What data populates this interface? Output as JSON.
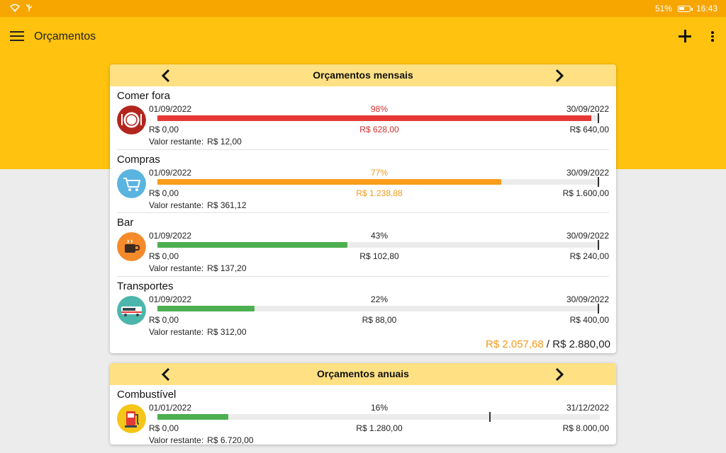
{
  "status": {
    "battery": "51%",
    "time": "16:43"
  },
  "app": {
    "title": "Orçamentos"
  },
  "monthly": {
    "title": "Orçamentos mensais",
    "items": [
      {
        "name": "Comer fora",
        "icon": "dinner-plate-icon",
        "start": "01/09/2022",
        "end": "30/09/2022",
        "pct": "98%",
        "progress": 0.98,
        "marker": 0.995,
        "min": "R$ 0,00",
        "spent": "R$ 628,00",
        "limit": "R$ 640,00",
        "rem_label": "Valor restante:",
        "rem": "R$ 12,00",
        "color": "#e53935",
        "text_color": "#d32f2f"
      },
      {
        "name": "Compras",
        "icon": "shopping-cart-icon",
        "start": "01/09/2022",
        "end": "30/09/2022",
        "pct": "77%",
        "progress": 0.777,
        "marker": 0.995,
        "min": "R$ 0,00",
        "spent": "R$ 1.238,88",
        "limit": "R$ 1.600,00",
        "rem_label": "Valor restante:",
        "rem": "R$ 361,12",
        "color": "#f99d1c",
        "text_color": "#f29a1c"
      },
      {
        "name": "Bar",
        "icon": "coffee-cup-icon",
        "start": "01/09/2022",
        "end": "30/09/2022",
        "pct": "43%",
        "progress": 0.43,
        "marker": 0.995,
        "min": "R$ 0,00",
        "spent": "R$ 102,80",
        "limit": "R$ 240,00",
        "rem_label": "Valor restante:",
        "rem": "R$ 137,20",
        "color": "#4caf50",
        "text_color": "#222222"
      },
      {
        "name": "Transportes",
        "icon": "bus-icon",
        "start": "01/09/2022",
        "end": "30/09/2022",
        "pct": "22%",
        "progress": 0.22,
        "marker": 0.995,
        "min": "R$ 0,00",
        "spent": "R$ 88,00",
        "limit": "R$ 400,00",
        "rem_label": "Valor restante:",
        "rem": "R$ 312,00",
        "color": "#4caf50",
        "text_color": "#222222"
      }
    ],
    "total_spent": "R$ 2.057,68",
    "total_sep": "/",
    "total_limit": "R$ 2.880,00"
  },
  "annual": {
    "title": "Orçamentos anuais",
    "items": [
      {
        "name": "Combustível",
        "icon": "fuel-pump-icon",
        "start": "01/01/2022",
        "end": "31/12/2022",
        "pct": "16%",
        "progress": 0.16,
        "marker": 0.75,
        "min": "R$ 0,00",
        "spent": "R$ 1.280,00",
        "limit": "R$ 8.000,00",
        "rem_label": "Valor restante:",
        "rem": "R$ 6.720,00",
        "color": "#4caf50",
        "text_color": "#222222"
      }
    ]
  }
}
